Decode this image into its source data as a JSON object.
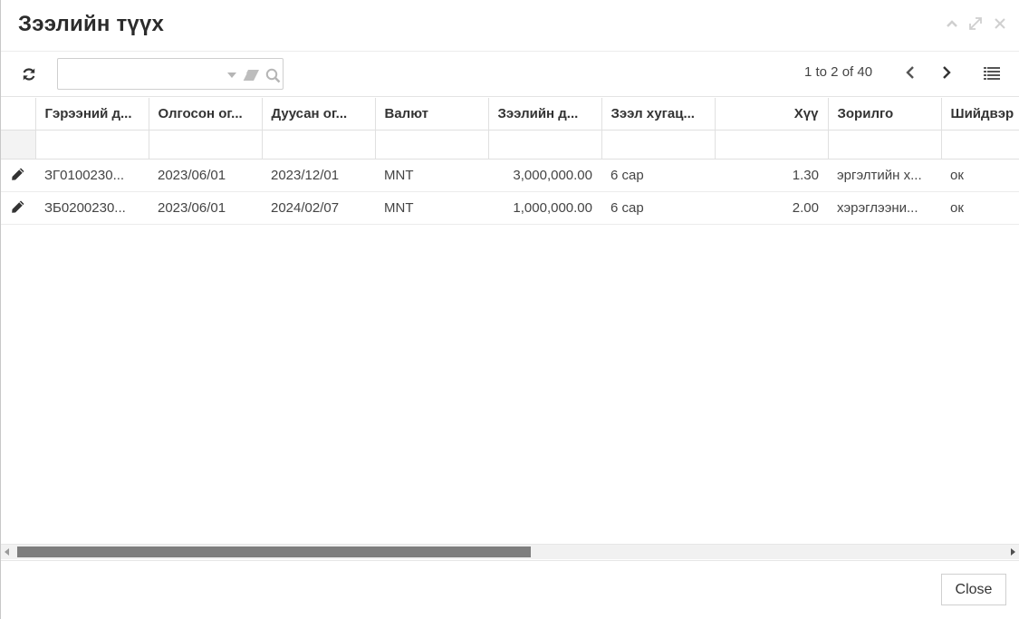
{
  "dialog": {
    "title": "Зээлийн түүх",
    "controls": {
      "collapse_icon": "chevron-up-icon",
      "maximize_icon": "expand-icon",
      "close_icon": "close-icon"
    }
  },
  "toolbar": {
    "refresh_icon": "refresh-icon",
    "search": {
      "value": "",
      "placeholder": ""
    },
    "pager": {
      "text": "1 to 2 of 40"
    },
    "columns_icon": "list-icon"
  },
  "grid": {
    "columns": [
      {
        "label": ""
      },
      {
        "label": "Гэрээний д..."
      },
      {
        "label": "Олгосон ог..."
      },
      {
        "label": "Дуусан ог..."
      },
      {
        "label": "Валют"
      },
      {
        "label": "Зээлийн д..."
      },
      {
        "label": "Зээл хугац..."
      },
      {
        "label": "Хүү"
      },
      {
        "label": "Зорилго"
      },
      {
        "label": "Шийдвэр"
      }
    ],
    "rows": [
      {
        "contract": "ЗГ0100230...",
        "issued": "2023/06/01",
        "ended": "2023/12/01",
        "currency": "MNT",
        "amount": "3,000,000.00",
        "term": "6 сар",
        "rate": "1.30",
        "purpose": "эргэлтийн х...",
        "decision": "ок"
      },
      {
        "contract": "ЗБ0200230...",
        "issued": "2023/06/01",
        "ended": "2024/02/07",
        "currency": "MNT",
        "amount": "1,000,000.00",
        "term": "6 сар",
        "rate": "2.00",
        "purpose": "хэрэглээни...",
        "decision": "ок"
      }
    ]
  },
  "footer": {
    "close_label": "Close"
  }
}
